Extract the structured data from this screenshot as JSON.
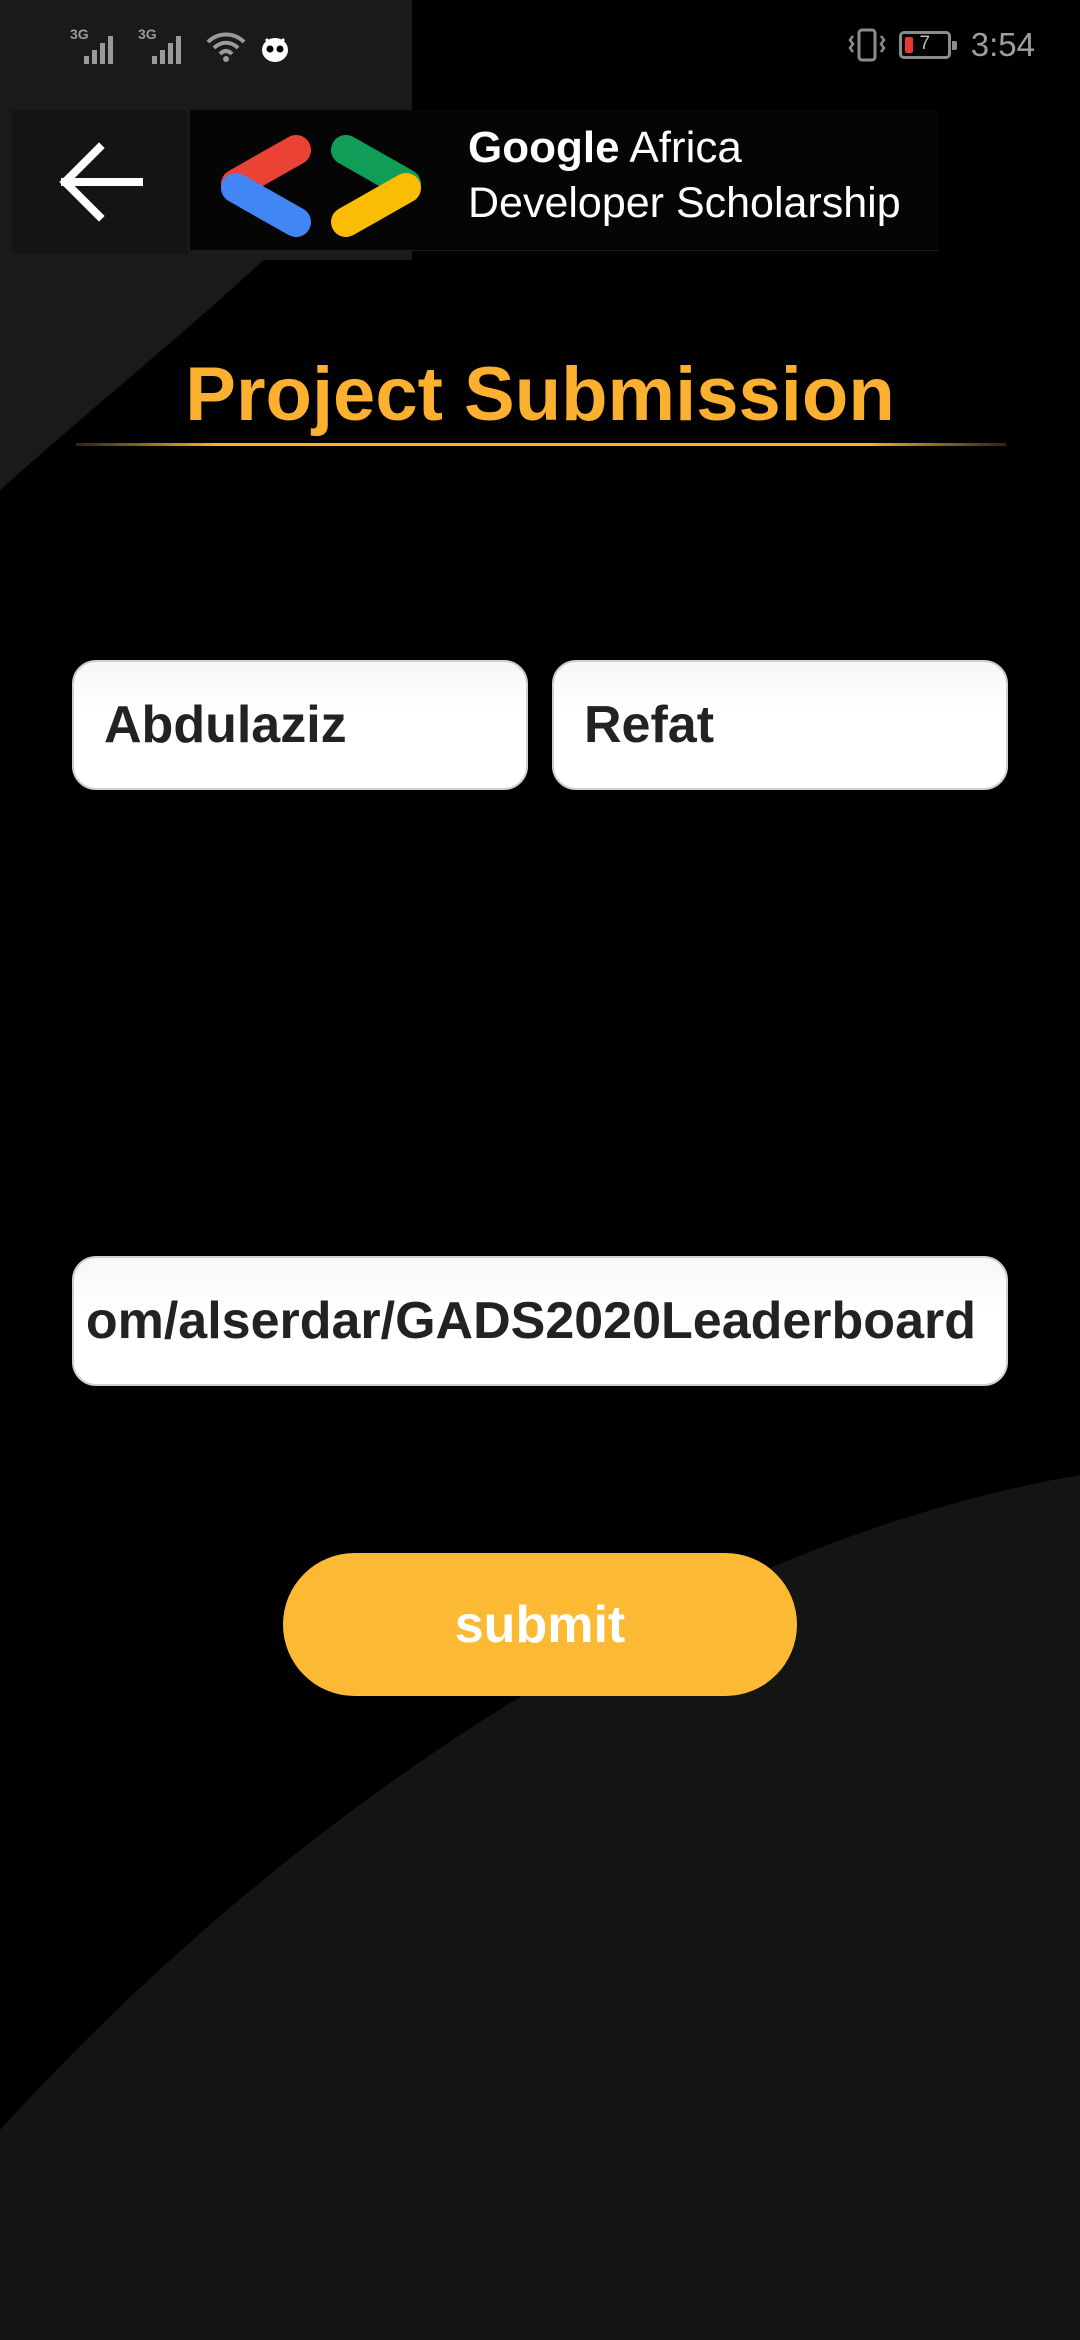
{
  "status_bar": {
    "signal_1_label": "3G",
    "signal_2_label": "3G",
    "battery_level": "7",
    "time": "3:54"
  },
  "toolbar": {
    "back_icon": "arrow-left-icon",
    "logo_icon": "google-developers-chevrons-logo",
    "brand_google": "Google",
    "brand_africa": "Africa",
    "brand_line2": "Developer Scholarship"
  },
  "page": {
    "title": "Project Submission"
  },
  "form": {
    "first_name_value": "Abdulaziz",
    "last_name_value": "Refat",
    "link_value": "om/alserdar/GADS2020Leaderboard",
    "submit_label": "submit"
  },
  "colors": {
    "accent": "#fbb030",
    "button": "#fbb934",
    "background": "#000000",
    "field_bg": "#ffffff",
    "logo_red": "#ea4335",
    "logo_blue": "#4285f4",
    "logo_green": "#0f9d58",
    "logo_yellow": "#fbbc04"
  }
}
